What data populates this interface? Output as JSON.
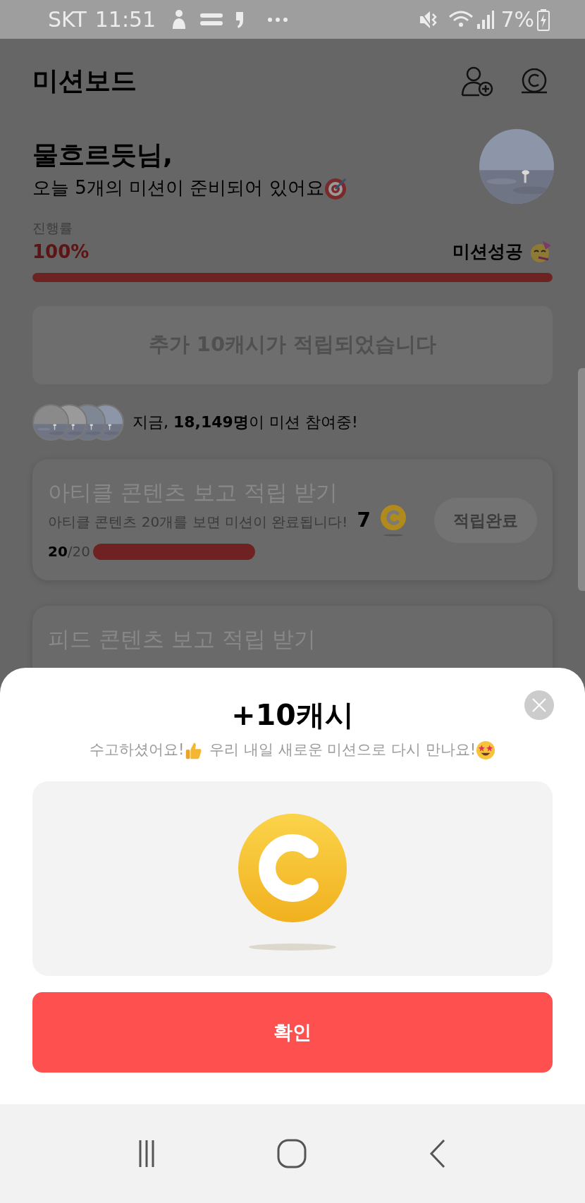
{
  "status_bar": {
    "carrier": "SKT",
    "time": "11:51",
    "battery": "7%"
  },
  "header": {
    "title": "미션보드"
  },
  "greeting": {
    "name": "물흐르듯님,",
    "message": "오늘 5개의 미션이 준비되어 있어요"
  },
  "progress": {
    "label": "진행률",
    "value": "100%",
    "level": 1,
    "status": "미션성공"
  },
  "bonus_banner": "추가 10캐시가 적립되었습니다",
  "participants": {
    "text": "지금, **18,149명**이 미션 참여중!"
  },
  "missions": [
    {
      "title": "아티클 콘텐츠 보고 적립 받기",
      "description": "아티클 콘텐츠 20개를 보면 미션이 완료됩니다!",
      "count": "20",
      "total": "/20",
      "level": 1,
      "reward": "7",
      "button": "적립완료"
    },
    {
      "title": "피드 콘텐츠 보고 적립 받기"
    }
  ],
  "modal": {
    "title": "+10캐시",
    "message_parts": [
      "수고하셨어요!",
      "우리 내일 새로운 미션으로 다시 만나요!"
    ],
    "confirm_button": "확인"
  }
}
